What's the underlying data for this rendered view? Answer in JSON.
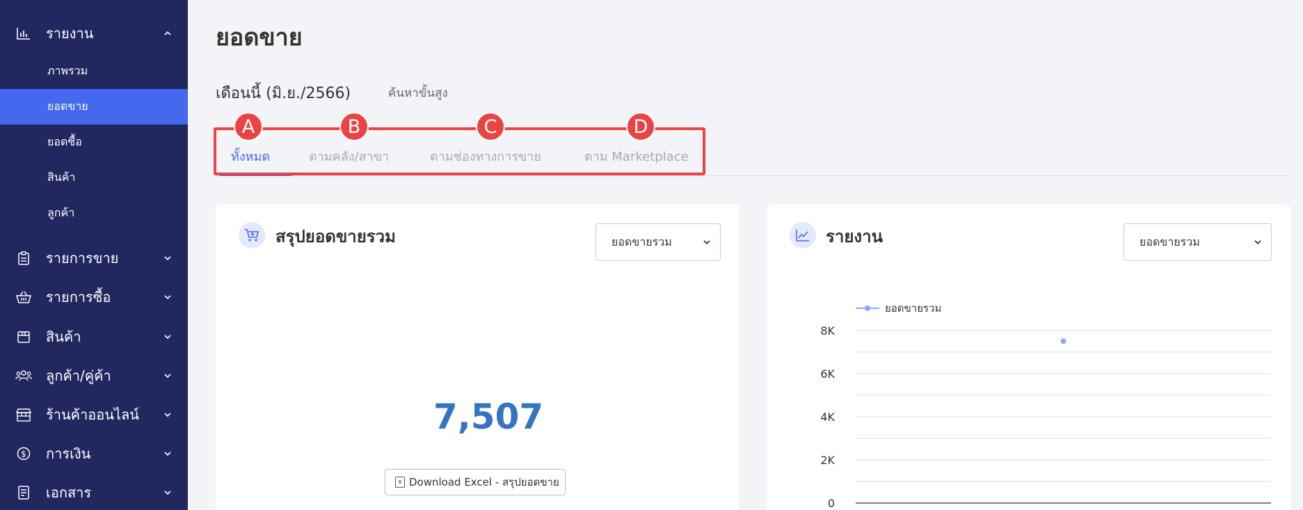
{
  "sidebar": {
    "report": {
      "label": "รายงาน",
      "icon": "bar-chart-icon",
      "expanded": true
    },
    "report_items": [
      {
        "label": "ภาพรวม",
        "active": false
      },
      {
        "label": "ยอดขาย",
        "active": true
      },
      {
        "label": "ยอดซื้อ",
        "active": false
      },
      {
        "label": "สินค้า",
        "active": false
      },
      {
        "label": "ลูกค้า",
        "active": false
      }
    ],
    "sections": [
      {
        "label": "รายการขาย",
        "icon": "clipboard-icon"
      },
      {
        "label": "รายการซื้อ",
        "icon": "basket-icon"
      },
      {
        "label": "สินค้า",
        "icon": "box-icon"
      },
      {
        "label": "ลูกค้า/คู่ค้า",
        "icon": "users-icon"
      },
      {
        "label": "ร้านค้าออนไลน์",
        "icon": "store-icon"
      },
      {
        "label": "การเงิน",
        "icon": "dollar-icon"
      },
      {
        "label": "เอกสาร",
        "icon": "document-icon"
      }
    ]
  },
  "main": {
    "title": "ยอดขาย",
    "period": "เดือนนี้ (มิ.ย./2566)",
    "advanced_search": "ค้นหาขั้นสูง",
    "tabs": [
      {
        "label": "ทั้งหมด",
        "badge": "A",
        "active": true
      },
      {
        "label": "ตามคลัง/สาขา",
        "badge": "B",
        "active": false
      },
      {
        "label": "ตามช่องทางการขาย",
        "badge": "C",
        "active": false
      },
      {
        "label": "ตาม Marketplace",
        "badge": "D",
        "active": false
      }
    ]
  },
  "summary_card": {
    "title": "สรุปยอดขายรวม",
    "select_value": "ยอดขายรวม",
    "total": "7,507",
    "download_label": "Download Excel - สรุปยอดขาย",
    "icon": "cart-icon"
  },
  "report_card": {
    "title": "รายงาน",
    "select_value": "ยอดขายรวม",
    "icon": "line-chart-icon"
  },
  "colors": {
    "sidebar_bg": "#22275f",
    "accent": "#4468ee",
    "callout": "#ea4343",
    "number": "#3574c0"
  },
  "chart_data": {
    "type": "line",
    "series": [
      {
        "name": "ยอดขายรวม",
        "values": [
          7507
        ]
      }
    ],
    "x_position_fraction": [
      0.5
    ],
    "ylim": [
      0,
      8000
    ],
    "y_ticks": [
      "8K",
      "6K",
      "4K",
      "2K",
      "0"
    ],
    "grid": true,
    "legend": "top-left"
  }
}
